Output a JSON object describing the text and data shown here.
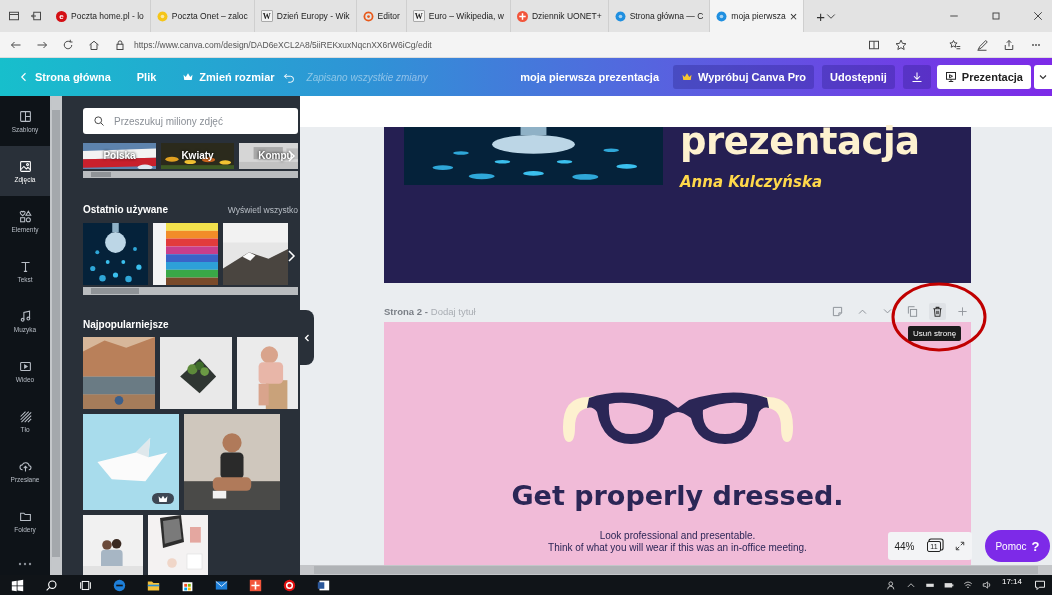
{
  "browser": {
    "tabs": [
      {
        "title": "Poczta home.pl - lo",
        "favicon": {
          "kind": "letter",
          "glyph": "e",
          "color": "#d40f14"
        },
        "selected": false
      },
      {
        "title": "Poczta Onet – zaloc",
        "favicon": {
          "kind": "dot",
          "color": "#f5c518"
        },
        "selected": false
      },
      {
        "title": "Dzień Europy - Wik",
        "favicon": {
          "kind": "wiki",
          "glyph": "W"
        },
        "selected": false
      },
      {
        "title": "Editor",
        "favicon": {
          "kind": "ring",
          "color": "#e8591a"
        },
        "selected": false
      },
      {
        "title": "Euro – Wikipedia, w",
        "favicon": {
          "kind": "wiki",
          "glyph": "W"
        },
        "selected": false
      },
      {
        "title": "Dziennik UONET+",
        "favicon": {
          "kind": "tile",
          "color": "#f2553b"
        },
        "selected": false
      },
      {
        "title": "Strona główna — C",
        "favicon": {
          "kind": "dot",
          "color": "#1f8fe0"
        },
        "selected": false
      },
      {
        "title": "moja pierwsza",
        "favicon": {
          "kind": "dot",
          "color": "#1f8fe0"
        },
        "selected": true,
        "close": "×"
      }
    ],
    "new_tab": "+",
    "url": "https://www.canva.com/design/DAD6eXCL2A8/5iiREKxuxNqcnXX6rW6iCg/edit"
  },
  "canva_bar": {
    "home": "Strona główna",
    "file": "Plik",
    "resize": "Zmień rozmiar",
    "saved": "Zapisano wszystkie zmiany",
    "title": "moja pierwsza prezentacja",
    "pro": "Wypróbuj Canva Pro",
    "share": "Udostępnij",
    "present": "Prezentacja"
  },
  "rail": {
    "items": [
      {
        "label": "Szablony",
        "kind": "templates",
        "selected": false
      },
      {
        "label": "Zdjęcia",
        "kind": "photos",
        "selected": true
      },
      {
        "label": "Elementy",
        "kind": "elements",
        "selected": false
      },
      {
        "label": "Tekst",
        "kind": "text",
        "selected": false
      },
      {
        "label": "Muzyka",
        "kind": "music",
        "selected": false
      },
      {
        "label": "Wideo",
        "kind": "video",
        "selected": false
      },
      {
        "label": "Tło",
        "kind": "background",
        "selected": false
      },
      {
        "label": "Przesłane",
        "kind": "uploads",
        "selected": false
      },
      {
        "label": "Foldery",
        "kind": "folders",
        "selected": false
      }
    ]
  },
  "panel": {
    "search": {
      "placeholder": "Przeszukuj miliony zdjęć"
    },
    "categories": [
      "Polska",
      "Kwiaty",
      "Kompu"
    ],
    "recent": "Ostatnio używane",
    "view_all": "Wyświetl wszystko",
    "popular": "Najpopularniejsze"
  },
  "canvas": {
    "page1": {
      "title": "prezentacja",
      "author": "Anna Kulczyńska"
    },
    "page2": {
      "label": "Strona 2 -",
      "add_title": "Dodaj tytuł",
      "heading": "Get properly dressed.",
      "lines": [
        "Look professional and presentable.",
        "Think of what you will wear if this was an in-office meeting."
      ]
    },
    "tooltip": "Usuń stronę",
    "zoom": "44%",
    "page_count": "11",
    "help": {
      "label": "Pomoc",
      "icon": "?"
    }
  },
  "taskbar": {
    "clock": "17:14"
  }
}
